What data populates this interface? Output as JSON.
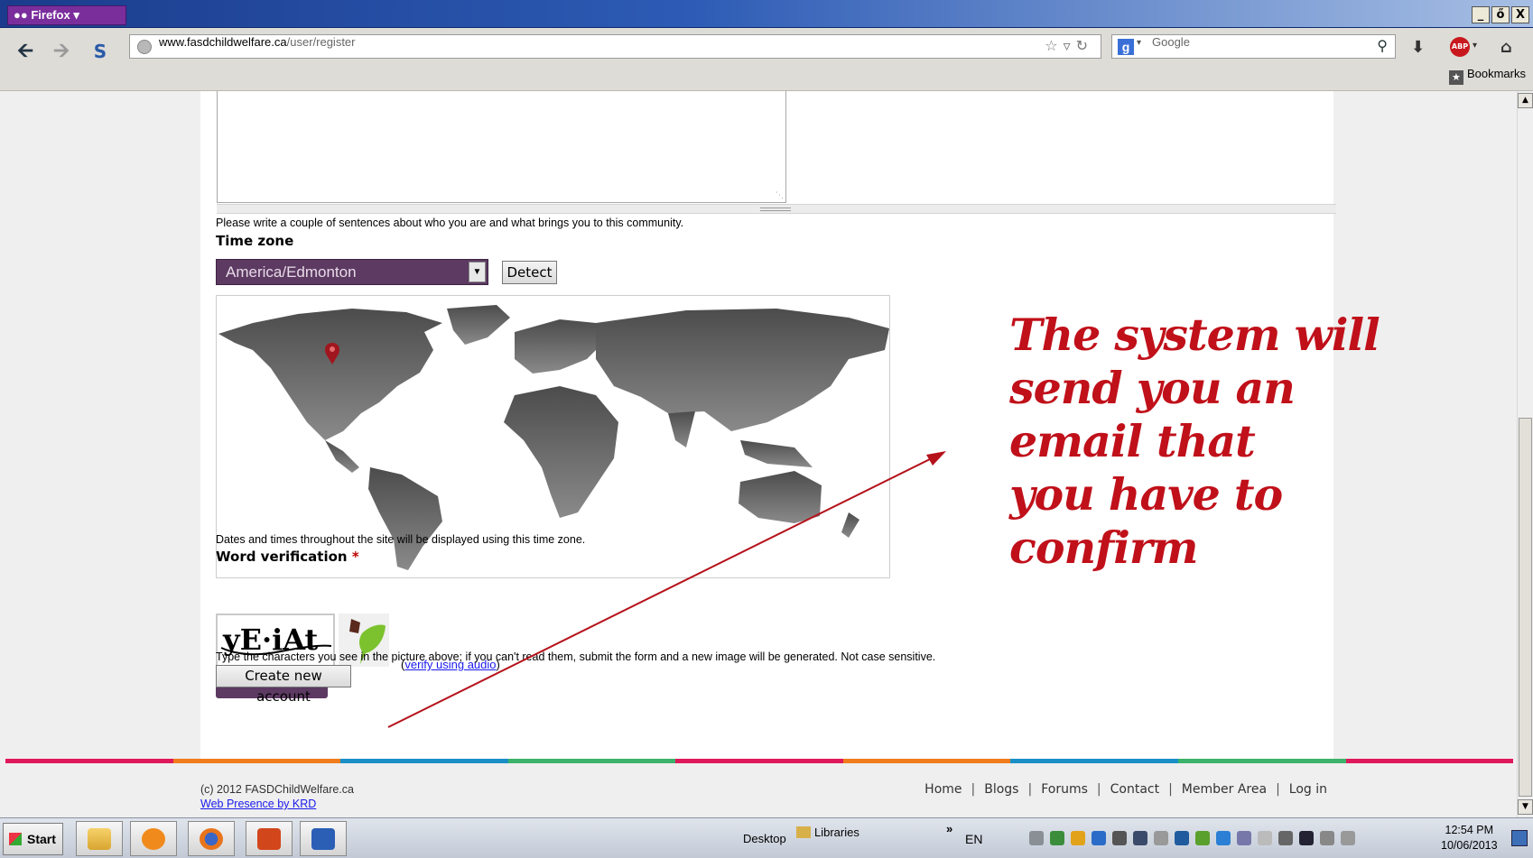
{
  "browser": {
    "app_button": "Firefox",
    "url_host": "www.fasdchildwelfare.ca",
    "url_path": "/user/register",
    "search_placeholder": "Google",
    "bookmarks_label": "Bookmarks",
    "window_controls": [
      "_",
      "ő",
      "X"
    ]
  },
  "form": {
    "about_hint": "Please write a couple of sentences about who you are and what brings you to this community.",
    "timezone_label": "Time zone",
    "timezone_value": "America/Edmonton",
    "detect_button": "Detect",
    "timezone_hint": "Dates and times throughout the site will be displayed using this time zone.",
    "captcha_label": "Word verification",
    "captcha_required_mark": "*",
    "captcha_text": "yE·iAt",
    "audio_open": "(",
    "audio_link": "verify using audio",
    "audio_close": ")",
    "captcha_hint": "Type the characters you see in the picture above; if you can't read them, submit the form and a new image will be generated. Not case sensitive.",
    "submit_button": "Create new account"
  },
  "annotation": {
    "lines": [
      "The system will",
      "send you an",
      "email that",
      "you have to",
      "confirm"
    ],
    "color": "#c0101a"
  },
  "footer": {
    "copyright": "(c) 2012 FASDChildWelfare.ca",
    "credit": "Web Presence by KRD",
    "nav": [
      "Home",
      "Blogs",
      "Forums",
      "Contact",
      "Member Area",
      "Log in"
    ],
    "stripe_colors": [
      "#e0185c",
      "#f07c1e",
      "#1a8fc6",
      "#3bb36b",
      "#e0185c",
      "#f07c1e",
      "#1a8fc6",
      "#3bb36b",
      "#e0185c"
    ]
  },
  "taskbar": {
    "start_label": "Start",
    "desktop_label": "Desktop",
    "libraries_label": "Libraries",
    "overflow": "»",
    "lang": "EN",
    "time": "12:54 PM",
    "date": "10/06/2013"
  }
}
